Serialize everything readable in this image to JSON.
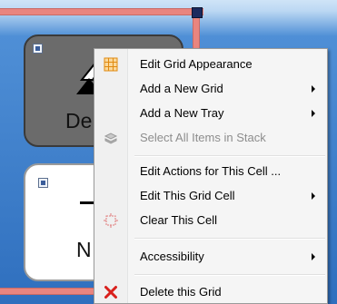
{
  "cells": [
    {
      "text": "De",
      "style": "dark"
    },
    {
      "text": "N",
      "style": "light"
    }
  ],
  "context_menu": {
    "items": [
      {
        "label": "Edit Grid Appearance",
        "icon": "grid-appearance-icon",
        "submenu": false,
        "enabled": true
      },
      {
        "label": "Add a New Grid",
        "icon": "",
        "submenu": true,
        "enabled": true
      },
      {
        "label": "Add a New Tray",
        "icon": "",
        "submenu": true,
        "enabled": true
      },
      {
        "label": "Select All Items in Stack",
        "icon": "stack-icon",
        "submenu": false,
        "enabled": false
      },
      {
        "label": "Edit Actions for This Cell ...",
        "icon": "",
        "submenu": false,
        "enabled": true
      },
      {
        "label": "Edit This Grid Cell",
        "icon": "",
        "submenu": true,
        "enabled": true
      },
      {
        "label": "Clear This Cell",
        "icon": "clear-cell-icon",
        "submenu": false,
        "enabled": true
      },
      {
        "label": "Accessibility",
        "icon": "",
        "submenu": true,
        "enabled": true
      },
      {
        "label": "Delete this Grid",
        "icon": "delete-x-icon",
        "submenu": false,
        "enabled": true
      }
    ]
  },
  "colors": {
    "background": "#4a87cf",
    "selection_border": "#e9857f",
    "delete_icon": "#d9201c",
    "grid_icon": "#f0a020"
  }
}
